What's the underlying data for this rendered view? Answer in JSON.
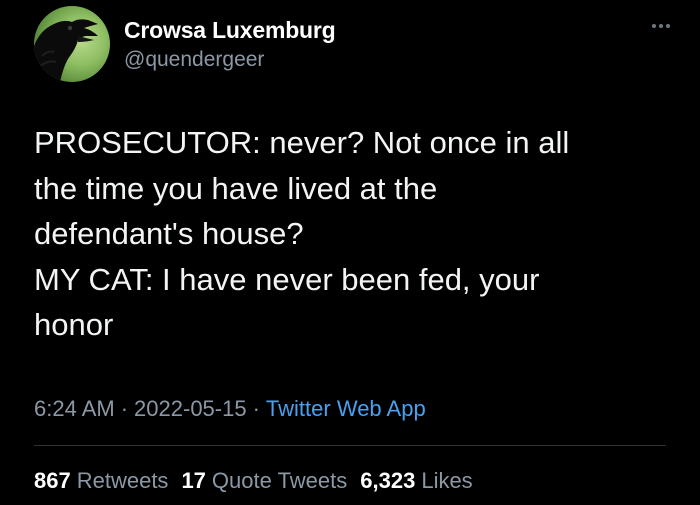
{
  "author": {
    "display_name": "Crowsa Luxemburg",
    "handle": "@quendergeer",
    "avatar_icon": "crow-avatar-icon"
  },
  "tweet": {
    "text": "PROSECUTOR: never? Not once in all\nthe time you have lived at the\ndefendant's house?\nMY CAT: I have never been fed, your\nhonor",
    "time": "6:24 AM",
    "date": "2022-05-15",
    "separator": "·",
    "source": "Twitter Web App"
  },
  "stats": {
    "retweets": {
      "count": "867",
      "label": "Retweets"
    },
    "quotes": {
      "count": "17",
      "label": "Quote Tweets"
    },
    "likes": {
      "count": "6,323",
      "label": "Likes"
    }
  },
  "colors": {
    "background": "#000000",
    "text": "#f3f4f5",
    "secondary": "#8b98a5",
    "link": "#4a9ff0"
  }
}
